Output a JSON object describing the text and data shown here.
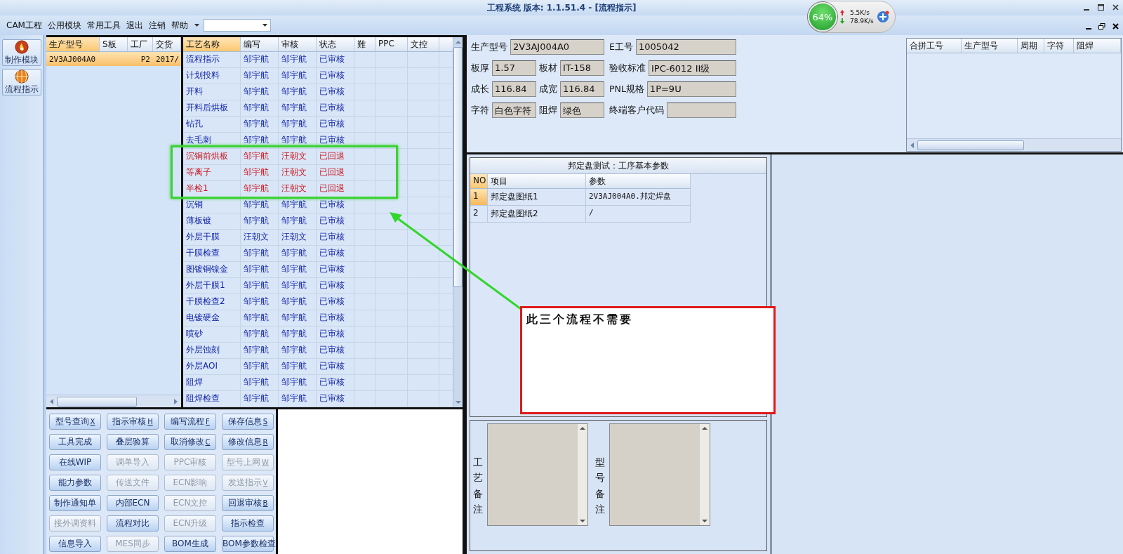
{
  "window": {
    "title": "工程系统  版本: 1.1.51.4 - [流程指示]"
  },
  "network_widget": {
    "percent": "64%",
    "upload": "5.5K/s",
    "download": "78.9K/s"
  },
  "menu": {
    "items": [
      "CAM工程",
      "公用模块",
      "常用工具",
      "退出",
      "注销",
      "帮助"
    ]
  },
  "side_toolbar": [
    {
      "label": "制作模块",
      "kind": "fire"
    },
    {
      "label": "流程指示",
      "kind": "ball"
    }
  ],
  "product_list": {
    "columns": [
      "生产型号",
      "S板",
      "工厂",
      "交货"
    ],
    "rows": [
      {
        "cells": [
          "2V3AJ004A0",
          "",
          "P2",
          "2017/"
        ],
        "selected": true
      }
    ]
  },
  "process_table": {
    "columns": [
      "工艺名称",
      "编写",
      "审核",
      "状态",
      "難",
      "PPC",
      "文控"
    ],
    "rows": [
      {
        "cells": [
          "流程指示",
          "邹宇航",
          "邹宇航",
          "已审核"
        ],
        "rejected": false
      },
      {
        "cells": [
          "计划投料",
          "邹宇航",
          "邹宇航",
          "已审核"
        ],
        "rejected": false
      },
      {
        "cells": [
          "开料",
          "邹宇航",
          "邹宇航",
          "已审核"
        ],
        "rejected": false
      },
      {
        "cells": [
          "开料后烘板",
          "邹宇航",
          "邹宇航",
          "已审核"
        ],
        "rejected": false
      },
      {
        "cells": [
          "钻孔",
          "邹宇航",
          "邹宇航",
          "已审核"
        ],
        "rejected": false
      },
      {
        "cells": [
          "去毛刺",
          "邹宇航",
          "邹宇航",
          "已审核"
        ],
        "rejected": false
      },
      {
        "cells": [
          "沉铜前烘板",
          "邹宇航",
          "汪朝文",
          "已回退"
        ],
        "rejected": true
      },
      {
        "cells": [
          "等离子",
          "邹宇航",
          "汪朝文",
          "已回退"
        ],
        "rejected": true
      },
      {
        "cells": [
          "半检1",
          "邹宇航",
          "汪朝文",
          "已回退"
        ],
        "rejected": true
      },
      {
        "cells": [
          "沉铜",
          "邹宇航",
          "邹宇航",
          "已审核"
        ],
        "rejected": false
      },
      {
        "cells": [
          "薄板镀",
          "邹宇航",
          "邹宇航",
          "已审核"
        ],
        "rejected": false
      },
      {
        "cells": [
          "外层干膜",
          "汪朝文",
          "汪朝文",
          "已审核"
        ],
        "rejected": false
      },
      {
        "cells": [
          "干膜检查",
          "邹宇航",
          "邹宇航",
          "已审核"
        ],
        "rejected": false
      },
      {
        "cells": [
          "图镀铜镍金",
          "邹宇航",
          "邹宇航",
          "已审核"
        ],
        "rejected": false
      },
      {
        "cells": [
          "外层干膜1",
          "邹宇航",
          "邹宇航",
          "已审核"
        ],
        "rejected": false
      },
      {
        "cells": [
          "干膜检查2",
          "邹宇航",
          "邹宇航",
          "已审核"
        ],
        "rejected": false
      },
      {
        "cells": [
          "电镀硬金",
          "邹宇航",
          "邹宇航",
          "已审核"
        ],
        "rejected": false
      },
      {
        "cells": [
          "喷砂",
          "邹宇航",
          "邹宇航",
          "已审核"
        ],
        "rejected": false
      },
      {
        "cells": [
          "外层蚀刻",
          "邹宇航",
          "邹宇航",
          "已审核"
        ],
        "rejected": false
      },
      {
        "cells": [
          "外层AOI",
          "邹宇航",
          "邹宇航",
          "已审核"
        ],
        "rejected": false
      },
      {
        "cells": [
          "阻焊",
          "邹宇航",
          "邹宇航",
          "已审核"
        ],
        "rejected": false
      },
      {
        "cells": [
          "阻焊检查",
          "邹宇航",
          "邹宇航",
          "已审核"
        ],
        "rejected": false
      }
    ]
  },
  "actions": [
    {
      "label": "型号查询",
      "shortcut": "X",
      "disabled": false
    },
    {
      "label": "指示审核",
      "shortcut": "H",
      "disabled": false
    },
    {
      "label": "编写流程",
      "shortcut": "F",
      "disabled": false
    },
    {
      "label": "保存信息",
      "shortcut": "S",
      "disabled": false
    },
    {
      "label": "工具完成",
      "disabled": false
    },
    {
      "label": "叠层验算",
      "disabled": false
    },
    {
      "label": "取消修改",
      "shortcut": "C",
      "disabled": false
    },
    {
      "label": "修改信息",
      "shortcut": "R",
      "disabled": false
    },
    {
      "label": "在线WIP",
      "disabled": false
    },
    {
      "label": "调单导入",
      "disabled": true
    },
    {
      "label": "PPC审核",
      "disabled": true
    },
    {
      "label": "型号上网",
      "shortcut": "W",
      "disabled": true
    },
    {
      "label": "能力参数",
      "disabled": false
    },
    {
      "label": "传送文件",
      "disabled": true
    },
    {
      "label": "ECN影响",
      "disabled": true
    },
    {
      "label": "发送指示",
      "shortcut": "V",
      "disabled": true
    },
    {
      "label": "制作通知单",
      "disabled": false
    },
    {
      "label": "内部ECN",
      "disabled": false
    },
    {
      "label": "ECN文控",
      "disabled": true
    },
    {
      "label": "回退审核",
      "shortcut": "B",
      "disabled": false
    },
    {
      "label": "接外调资料",
      "disabled": true
    },
    {
      "label": "流程对比",
      "disabled": false
    },
    {
      "label": "ECN升级",
      "disabled": true
    },
    {
      "label": "指示检查",
      "disabled": false
    },
    {
      "label": "信息导入",
      "disabled": false
    },
    {
      "label": "MES同步",
      "disabled": true
    },
    {
      "label": "BOM生成",
      "disabled": false
    },
    {
      "label": "BOM参数检查",
      "disabled": false
    }
  ],
  "job_info": {
    "rows": [
      [
        [
          {
            "label": "生产型号",
            "value": "2V3AJ004A0"
          }
        ],
        [
          {
            "label": "E工号",
            "value": "1005042"
          }
        ]
      ],
      [
        [
          {
            "label": "板厚",
            "value": "1.57"
          },
          {
            "label": "板材",
            "value": "IT-158"
          }
        ],
        [
          {
            "label": "验收标准",
            "value": "IPC-6012 II级"
          }
        ]
      ],
      [
        [
          {
            "label": "成长",
            "value": "116.84"
          },
          {
            "label": "成宽",
            "value": "116.84"
          }
        ],
        [
          {
            "label": "PNL规格",
            "value": "1P=9U"
          }
        ]
      ],
      [
        [
          {
            "label": "字符",
            "value": "白色字符"
          },
          {
            "label": "阻焊",
            "value": "绿色"
          }
        ],
        [
          {
            "label": "终端客户代码"
          }
        ]
      ]
    ]
  },
  "merge_table": {
    "columns": [
      "合拼工号",
      "生产型号",
      "周期",
      "字符",
      "阻焊"
    ]
  },
  "param_panel": {
    "title": "邦定盘测试：工序基本参数",
    "columns": [
      "NO",
      "项目",
      "参数"
    ],
    "rows": [
      {
        "cells": [
          "1",
          "邦定盘图纸1",
          "2V3AJ004A0.邦定焊盘"
        ],
        "selected": true
      },
      {
        "cells": [
          "2",
          "邦定盘图纸2",
          "/"
        ],
        "selected": false
      }
    ]
  },
  "remarks": [
    {
      "label": "工艺备注"
    },
    {
      "label": "型号备注"
    }
  ],
  "annotation": {
    "text": "此三个流程不需要"
  }
}
